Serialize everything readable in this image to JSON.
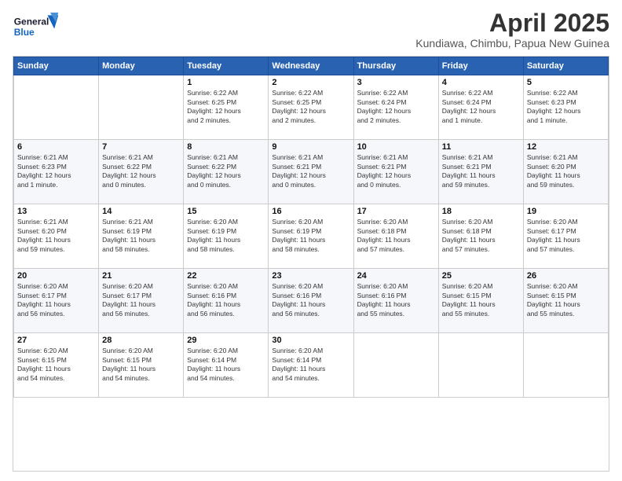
{
  "header": {
    "logo_general": "General",
    "logo_blue": "Blue",
    "month_title": "April 2025",
    "subtitle": "Kundiawa, Chimbu, Papua New Guinea"
  },
  "weekdays": [
    "Sunday",
    "Monday",
    "Tuesday",
    "Wednesday",
    "Thursday",
    "Friday",
    "Saturday"
  ],
  "weeks": [
    [
      {
        "day": "",
        "info": ""
      },
      {
        "day": "",
        "info": ""
      },
      {
        "day": "1",
        "info": "Sunrise: 6:22 AM\nSunset: 6:25 PM\nDaylight: 12 hours\nand 2 minutes."
      },
      {
        "day": "2",
        "info": "Sunrise: 6:22 AM\nSunset: 6:25 PM\nDaylight: 12 hours\nand 2 minutes."
      },
      {
        "day": "3",
        "info": "Sunrise: 6:22 AM\nSunset: 6:24 PM\nDaylight: 12 hours\nand 2 minutes."
      },
      {
        "day": "4",
        "info": "Sunrise: 6:22 AM\nSunset: 6:24 PM\nDaylight: 12 hours\nand 1 minute."
      },
      {
        "day": "5",
        "info": "Sunrise: 6:22 AM\nSunset: 6:23 PM\nDaylight: 12 hours\nand 1 minute."
      }
    ],
    [
      {
        "day": "6",
        "info": "Sunrise: 6:21 AM\nSunset: 6:23 PM\nDaylight: 12 hours\nand 1 minute."
      },
      {
        "day": "7",
        "info": "Sunrise: 6:21 AM\nSunset: 6:22 PM\nDaylight: 12 hours\nand 0 minutes."
      },
      {
        "day": "8",
        "info": "Sunrise: 6:21 AM\nSunset: 6:22 PM\nDaylight: 12 hours\nand 0 minutes."
      },
      {
        "day": "9",
        "info": "Sunrise: 6:21 AM\nSunset: 6:21 PM\nDaylight: 12 hours\nand 0 minutes."
      },
      {
        "day": "10",
        "info": "Sunrise: 6:21 AM\nSunset: 6:21 PM\nDaylight: 12 hours\nand 0 minutes."
      },
      {
        "day": "11",
        "info": "Sunrise: 6:21 AM\nSunset: 6:21 PM\nDaylight: 11 hours\nand 59 minutes."
      },
      {
        "day": "12",
        "info": "Sunrise: 6:21 AM\nSunset: 6:20 PM\nDaylight: 11 hours\nand 59 minutes."
      }
    ],
    [
      {
        "day": "13",
        "info": "Sunrise: 6:21 AM\nSunset: 6:20 PM\nDaylight: 11 hours\nand 59 minutes."
      },
      {
        "day": "14",
        "info": "Sunrise: 6:21 AM\nSunset: 6:19 PM\nDaylight: 11 hours\nand 58 minutes."
      },
      {
        "day": "15",
        "info": "Sunrise: 6:20 AM\nSunset: 6:19 PM\nDaylight: 11 hours\nand 58 minutes."
      },
      {
        "day": "16",
        "info": "Sunrise: 6:20 AM\nSunset: 6:19 PM\nDaylight: 11 hours\nand 58 minutes."
      },
      {
        "day": "17",
        "info": "Sunrise: 6:20 AM\nSunset: 6:18 PM\nDaylight: 11 hours\nand 57 minutes."
      },
      {
        "day": "18",
        "info": "Sunrise: 6:20 AM\nSunset: 6:18 PM\nDaylight: 11 hours\nand 57 minutes."
      },
      {
        "day": "19",
        "info": "Sunrise: 6:20 AM\nSunset: 6:17 PM\nDaylight: 11 hours\nand 57 minutes."
      }
    ],
    [
      {
        "day": "20",
        "info": "Sunrise: 6:20 AM\nSunset: 6:17 PM\nDaylight: 11 hours\nand 56 minutes."
      },
      {
        "day": "21",
        "info": "Sunrise: 6:20 AM\nSunset: 6:17 PM\nDaylight: 11 hours\nand 56 minutes."
      },
      {
        "day": "22",
        "info": "Sunrise: 6:20 AM\nSunset: 6:16 PM\nDaylight: 11 hours\nand 56 minutes."
      },
      {
        "day": "23",
        "info": "Sunrise: 6:20 AM\nSunset: 6:16 PM\nDaylight: 11 hours\nand 56 minutes."
      },
      {
        "day": "24",
        "info": "Sunrise: 6:20 AM\nSunset: 6:16 PM\nDaylight: 11 hours\nand 55 minutes."
      },
      {
        "day": "25",
        "info": "Sunrise: 6:20 AM\nSunset: 6:15 PM\nDaylight: 11 hours\nand 55 minutes."
      },
      {
        "day": "26",
        "info": "Sunrise: 6:20 AM\nSunset: 6:15 PM\nDaylight: 11 hours\nand 55 minutes."
      }
    ],
    [
      {
        "day": "27",
        "info": "Sunrise: 6:20 AM\nSunset: 6:15 PM\nDaylight: 11 hours\nand 54 minutes."
      },
      {
        "day": "28",
        "info": "Sunrise: 6:20 AM\nSunset: 6:15 PM\nDaylight: 11 hours\nand 54 minutes."
      },
      {
        "day": "29",
        "info": "Sunrise: 6:20 AM\nSunset: 6:14 PM\nDaylight: 11 hours\nand 54 minutes."
      },
      {
        "day": "30",
        "info": "Sunrise: 6:20 AM\nSunset: 6:14 PM\nDaylight: 11 hours\nand 54 minutes."
      },
      {
        "day": "",
        "info": ""
      },
      {
        "day": "",
        "info": ""
      },
      {
        "day": "",
        "info": ""
      }
    ]
  ]
}
